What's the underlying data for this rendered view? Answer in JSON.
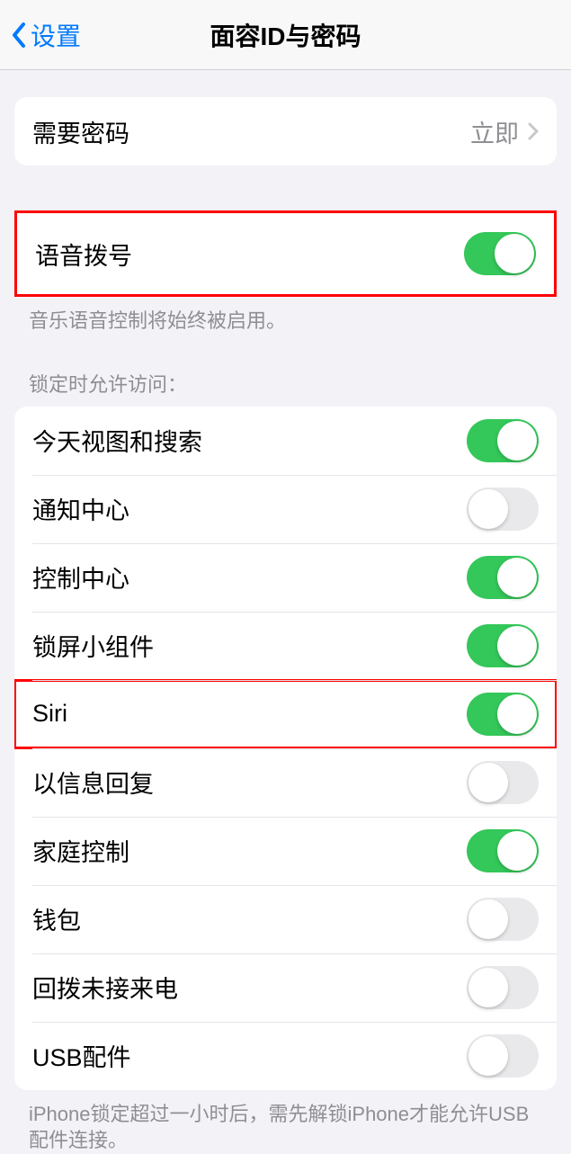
{
  "header": {
    "back_label": "设置",
    "title": "面容ID与密码"
  },
  "require_passcode": {
    "label": "需要密码",
    "value": "立即"
  },
  "voice_dial": {
    "label": "语音拨号",
    "on": true,
    "footer": "音乐语音控制将始终被启用。"
  },
  "locked_section": {
    "header": "锁定时允许访问：",
    "items": [
      {
        "label": "今天视图和搜索",
        "on": true
      },
      {
        "label": "通知中心",
        "on": false
      },
      {
        "label": "控制中心",
        "on": true
      },
      {
        "label": "锁屏小组件",
        "on": true
      },
      {
        "label": "Siri",
        "on": true
      },
      {
        "label": "以信息回复",
        "on": false
      },
      {
        "label": "家庭控制",
        "on": true
      },
      {
        "label": "钱包",
        "on": false
      },
      {
        "label": "回拨未接来电",
        "on": false
      },
      {
        "label": "USB配件",
        "on": false
      }
    ],
    "footer": "iPhone锁定超过一小时后，需先解锁iPhone才能允许USB配件连接。"
  }
}
